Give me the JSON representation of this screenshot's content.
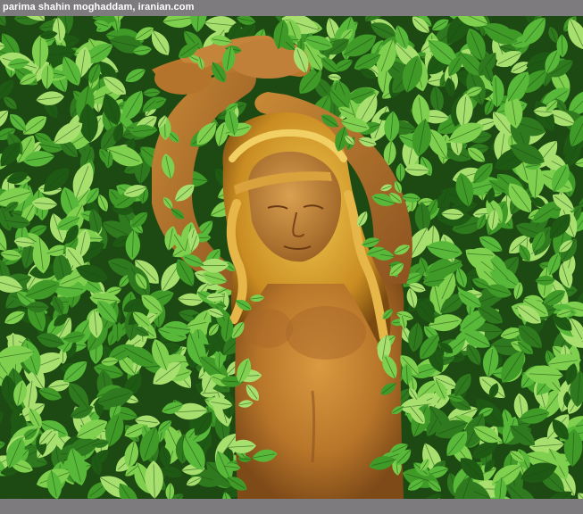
{
  "caption": {
    "text": "parima shahin moghaddam, iranian.com"
  },
  "artwork": {
    "leaf_colors": [
      "#1f5a14",
      "#2f7a1e",
      "#3f9a28",
      "#58b83a",
      "#7fd04e",
      "#a8e070"
    ],
    "statue_color": "#c8842c",
    "hair_color": "#d9a531"
  }
}
